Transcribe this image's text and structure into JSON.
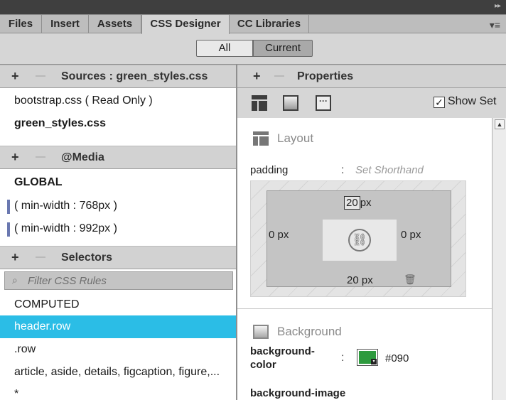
{
  "tabs": [
    {
      "label": "Files"
    },
    {
      "label": "Insert"
    },
    {
      "label": "Assets"
    },
    {
      "label": "CSS Designer"
    },
    {
      "label": "CC Libraries"
    }
  ],
  "toggle": {
    "all": "All",
    "current": "Current"
  },
  "sources": {
    "header": "Sources : green_styles.css",
    "items": [
      "bootstrap.css  ( Read Only )",
      "green_styles.css"
    ]
  },
  "media": {
    "header": "@Media",
    "items": [
      "GLOBAL",
      "( min-width : 768px )",
      "( min-width : 992px )"
    ]
  },
  "selectors": {
    "header": "Selectors",
    "filter_placeholder": "Filter CSS Rules",
    "items": [
      "COMPUTED",
      "header.row",
      ".row",
      "article, aside, details, figcaption, figure,...",
      "*"
    ]
  },
  "properties": {
    "header": "Properties",
    "show_set": "Show Set",
    "show_set_checked": true,
    "layout": {
      "title": "Layout",
      "padding_label": "padding",
      "colon": ":",
      "shorthand": "Set Shorthand",
      "top": "20",
      "top_unit": "px",
      "left": "0 px",
      "right": "0 px",
      "bottom": "20 px"
    },
    "background": {
      "title": "Background",
      "color_label_1": "background-",
      "color_label_2": "color",
      "colon": ":",
      "color_value": "#090",
      "swatch_color": "#2e9a3e",
      "image_label": "background-image"
    }
  },
  "icons": {
    "panel_menu": "panel-menu-icon",
    "collapse": "collapse-arrows-icon",
    "link": "link-icon",
    "trash": "trash-icon",
    "search": "search-icon"
  },
  "colors": {
    "selection": "#2bbde6",
    "media_bar": "#6a78b0"
  }
}
